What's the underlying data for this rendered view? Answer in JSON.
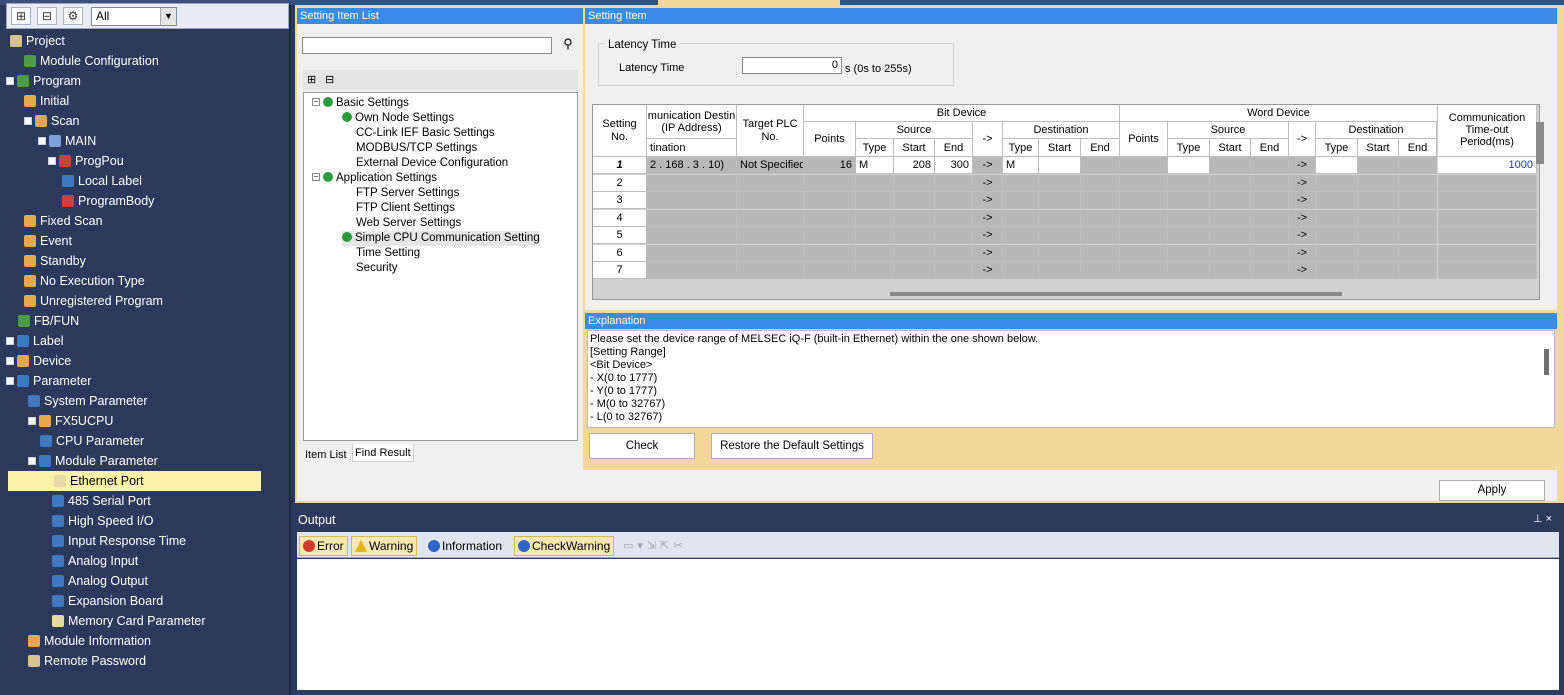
{
  "nav": {
    "filter": "All",
    "tree": [
      {
        "label": "Project",
        "icon": "project-icon"
      },
      {
        "label": "Module Configuration",
        "icon": "module-config-icon"
      },
      {
        "label": "Program",
        "icon": "program-icon"
      },
      {
        "label": "Initial",
        "icon": "folder-icon"
      },
      {
        "label": "Scan",
        "icon": "folder-icon"
      },
      {
        "label": "MAIN",
        "icon": "task-icon"
      },
      {
        "label": "ProgPou",
        "icon": "pou-icon"
      },
      {
        "label": "Local Label",
        "icon": "label-icon"
      },
      {
        "label": "ProgramBody",
        "icon": "program-body-icon"
      },
      {
        "label": "Fixed Scan",
        "icon": "folder-icon"
      },
      {
        "label": "Event",
        "icon": "folder-icon"
      },
      {
        "label": "Standby",
        "icon": "folder-icon"
      },
      {
        "label": "No Execution Type",
        "icon": "folder-icon"
      },
      {
        "label": "Unregistered Program",
        "icon": "folder-icon"
      },
      {
        "label": "FB/FUN",
        "icon": "fbfun-icon"
      },
      {
        "label": "Label",
        "icon": "label-icon"
      },
      {
        "label": "Device",
        "icon": "device-icon"
      },
      {
        "label": "Parameter",
        "icon": "parameter-icon"
      },
      {
        "label": "System Parameter",
        "icon": "parameter-icon"
      },
      {
        "label": "FX5UCPU",
        "icon": "cpu-icon"
      },
      {
        "label": "CPU Parameter",
        "icon": "parameter-icon"
      },
      {
        "label": "Module Parameter",
        "icon": "parameter-icon"
      },
      {
        "label": "Ethernet Port",
        "icon": "ethernet-icon"
      },
      {
        "label": "485 Serial Port",
        "icon": "parameter-icon"
      },
      {
        "label": "High Speed I/O",
        "icon": "parameter-icon"
      },
      {
        "label": "Input Response Time",
        "icon": "parameter-icon"
      },
      {
        "label": "Analog Input",
        "icon": "parameter-icon"
      },
      {
        "label": "Analog Output",
        "icon": "parameter-icon"
      },
      {
        "label": "Expansion Board",
        "icon": "parameter-icon"
      },
      {
        "label": "Memory Card Parameter",
        "icon": "memory-card-icon"
      },
      {
        "label": "Module Information",
        "icon": "module-info-icon"
      },
      {
        "label": "Remote Password",
        "icon": "password-icon"
      }
    ]
  },
  "setting_list": {
    "title": "Setting Item List",
    "items": [
      "Basic Settings",
      "Own Node Settings",
      "CC-Link IEF Basic Settings",
      "MODBUS/TCP Settings",
      "External Device Configuration",
      "Application Settings",
      "FTP Server Settings",
      "FTP Client Settings",
      "Web Server Settings",
      "Simple CPU Communication Setting",
      "Time Setting",
      "Security"
    ],
    "tabs": [
      "Item List",
      "Find Result"
    ]
  },
  "setting_item": {
    "title": "Setting Item",
    "latency_group": "Latency Time",
    "latency_label": "Latency Time",
    "latency_value": "0",
    "latency_unit": "s (0s to 255s)"
  },
  "grid": {
    "headers": {
      "setting_no": "Setting No.",
      "comm_dest": "munication Destin (IP Address)",
      "dest_sub": "tination",
      "target": "Target PLC No.",
      "bit_device": "Bit Device",
      "word_device": "Word Device",
      "points": "Points",
      "source": "Source",
      "arrow": "->",
      "destination": "Destination",
      "type": "Type",
      "start": "Start",
      "end": "End",
      "timeout": "Communication Time-out Period(ms)"
    },
    "rows": [
      {
        "no": "1",
        "ip": "2 . 168 . 3 . 10)",
        "target": "Not Specified",
        "points": "16",
        "src_type": "M",
        "src_start": "208",
        "src_end": "300",
        "arrow": "->",
        "dst_type": "M",
        "w_arrow": "->",
        "timeout": "1000"
      },
      {
        "no": "2",
        "arrow": "->",
        "w_arrow": "->"
      },
      {
        "no": "3",
        "arrow": "->",
        "w_arrow": "->"
      },
      {
        "no": "4",
        "arrow": "->",
        "w_arrow": "->"
      },
      {
        "no": "5",
        "arrow": "->",
        "w_arrow": "->"
      },
      {
        "no": "6",
        "arrow": "->",
        "w_arrow": "->"
      },
      {
        "no": "7",
        "arrow": "->",
        "w_arrow": "->"
      }
    ]
  },
  "explanation": {
    "title": "Explanation",
    "lines": [
      "Please set the device range of MELSEC iQ-F (built-in Ethernet) within the one shown below.",
      "[Setting Range]",
      "<Bit Device>",
      " - X(0 to 1777)",
      " - Y(0 to 1777)",
      " - M(0 to 32767)",
      " - L(0 to 32767)"
    ]
  },
  "buttons": {
    "check": "Check",
    "restore": "Restore the Default Settings",
    "apply": "Apply"
  },
  "output": {
    "title": "Output",
    "pin": "⊥ ×",
    "filters": [
      {
        "label": "Error",
        "color": "#d23b2b"
      },
      {
        "label": "Warning",
        "color": "#e8b21c"
      },
      {
        "label": "Information",
        "color": "#2f66c7"
      },
      {
        "label": "CheckWarning",
        "color": "#2f66c7"
      }
    ]
  }
}
